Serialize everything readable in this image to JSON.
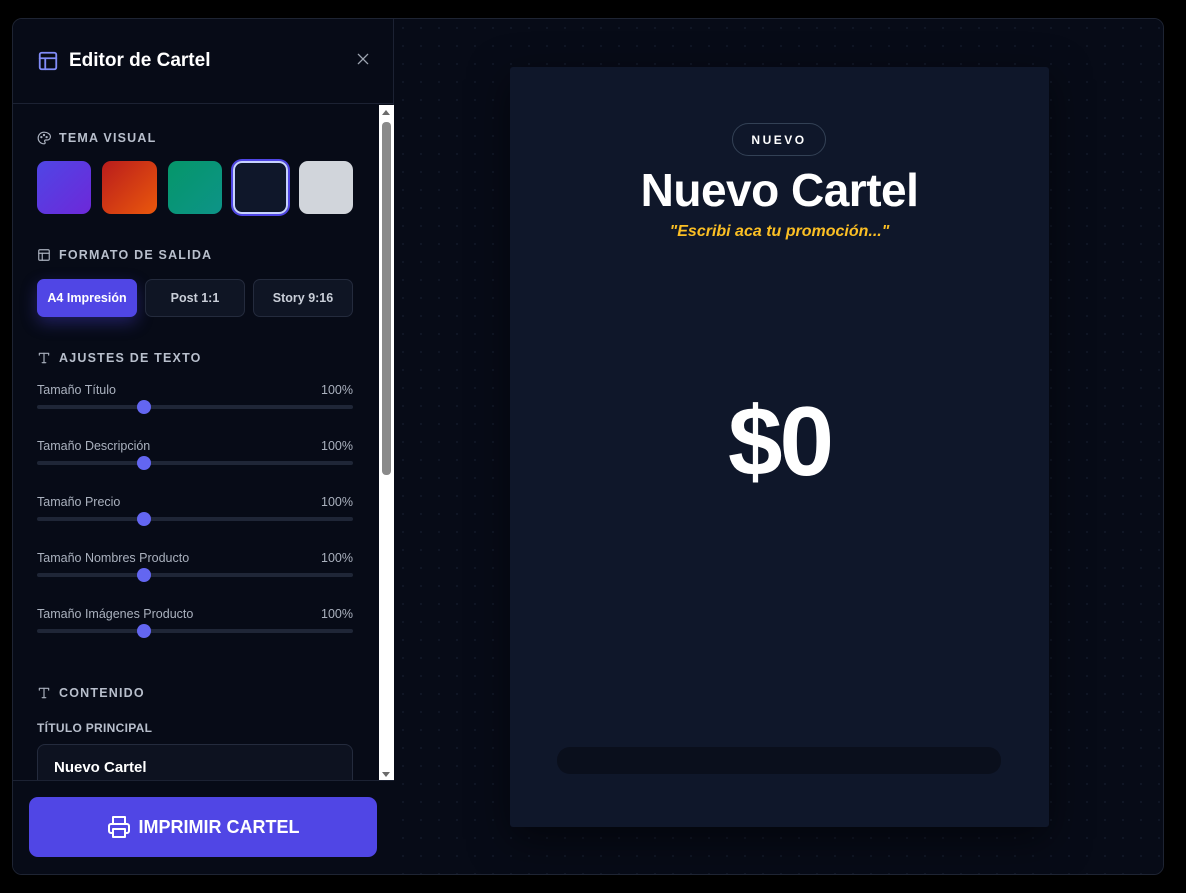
{
  "sidebar": {
    "title": "Editor de Cartel",
    "sections": {
      "theme": "TEMA VISUAL",
      "format": "FORMATO DE SALIDA",
      "text_settings": "AJUSTES DE TEXTO",
      "content": "CONTENIDO"
    },
    "themes": [
      {
        "name": "purple",
        "from": "#4f46e5",
        "to": "#6d28d9"
      },
      {
        "name": "red-orange",
        "from": "#b91c1c",
        "to": "#ea580c"
      },
      {
        "name": "green",
        "from": "#059669",
        "to": "#0d9488"
      },
      {
        "name": "dark",
        "from": "#0f172a",
        "to": "#0f172a",
        "selected": true
      },
      {
        "name": "light",
        "from": "#d1d5db",
        "to": "#d1d5db"
      }
    ],
    "formats": [
      {
        "label": "A4 Impresión",
        "active": true
      },
      {
        "label": "Post 1:1",
        "active": false
      },
      {
        "label": "Story 9:16",
        "active": false
      }
    ],
    "sliders": [
      {
        "label": "Tamaño Título",
        "value_text": "100%",
        "position": 0.34
      },
      {
        "label": "Tamaño Descripción",
        "value_text": "100%",
        "position": 0.34
      },
      {
        "label": "Tamaño Precio",
        "value_text": "100%",
        "position": 0.34
      },
      {
        "label": "Tamaño Nombres Producto",
        "value_text": "100%",
        "position": 0.34
      },
      {
        "label": "Tamaño Imágenes Producto",
        "value_text": "100%",
        "position": 0.34
      }
    ],
    "content": {
      "title_label": "TÍTULO PRINCIPAL",
      "title_value": "Nuevo Cartel"
    },
    "print_button": "IMPRIMIR CARTEL"
  },
  "poster": {
    "badge": "NUEVO",
    "title": "Nuevo Cartel",
    "description": "\"Escribi aca tu promoción...\"",
    "price": "$0"
  },
  "colors": {
    "accent": "#5046e5",
    "slider_knob": "#6366f1",
    "description": "#fbbf24",
    "poster_bg": "#0f172a"
  }
}
